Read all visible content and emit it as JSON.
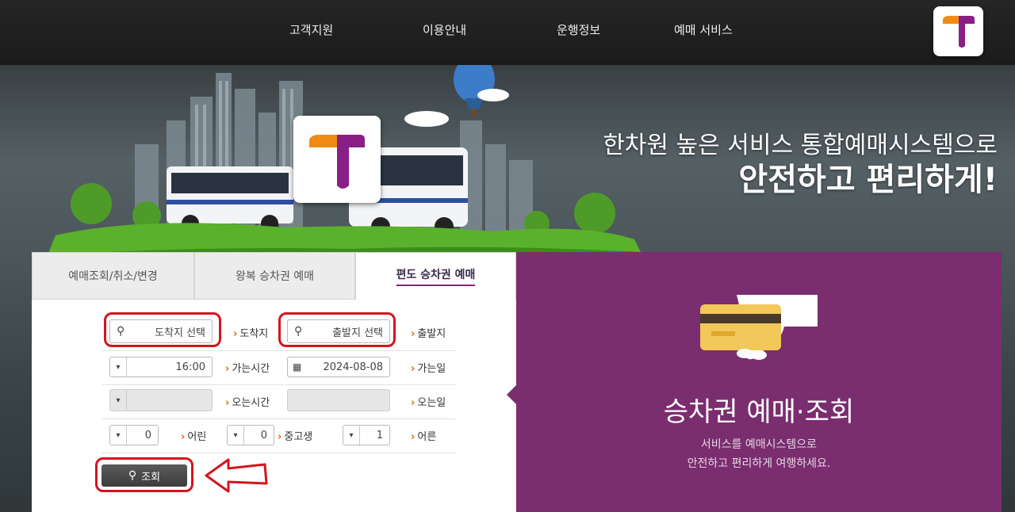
{
  "nav": {
    "items": [
      "고객지원",
      "이용안내",
      "운행정보",
      "예매 서비스"
    ]
  },
  "hero": {
    "line1": "한차원 높은 서비스 통합예매시스템으로",
    "line2": "안전하고 편리하게!"
  },
  "tabs": [
    "편도 승차권 예매",
    "왕복 승차권 예매",
    "예매조회/취소/변경"
  ],
  "form": {
    "departure": {
      "label": "출발지",
      "placeholder": "출발지 선택"
    },
    "arrival": {
      "label": "도착지",
      "placeholder": "도착지 선택"
    },
    "go_date": {
      "label": "가는일",
      "value": "2024-08-08"
    },
    "go_time": {
      "label": "가는시간",
      "value": "16:00"
    },
    "return_date": {
      "label": "오는일",
      "value": ""
    },
    "return_time": {
      "label": "오는시간",
      "value": ""
    },
    "adult": {
      "label": "어른",
      "value": "1"
    },
    "student": {
      "label": "중고생",
      "value": "0"
    },
    "child": {
      "label": "어린",
      "value": "0"
    },
    "search_label": "조회"
  },
  "promo": {
    "title": "승차권 예매·조회",
    "desc1": "서비스를 예매시스템으로",
    "desc2": "안전하고 편리하게 여행하세요."
  },
  "colors": {
    "brand_purple": "#7a2e6f",
    "brand_orange": "#f08a12",
    "highlight_red": "#d4141e"
  }
}
